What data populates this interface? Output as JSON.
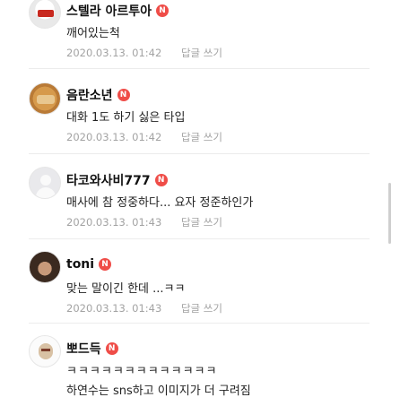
{
  "badge_label": "N",
  "reply_label": "답글 쓰기",
  "comments": [
    {
      "author": "스텔라 아르투아",
      "text": "깨어있는척",
      "timestamp": "2020.03.13. 01:42"
    },
    {
      "author": "음란소년",
      "text": "대화 1도 하기 싫은 타입",
      "timestamp": "2020.03.13. 01:42"
    },
    {
      "author": "타코와사비777",
      "text": "매사에 참 정중하다... 요자 정준하인가",
      "timestamp": "2020.03.13. 01:43"
    },
    {
      "author": "toni",
      "text": "맞는 말이긴 한데 ...ㅋㅋ",
      "timestamp": "2020.03.13. 01:43"
    },
    {
      "author": "뽀드득",
      "text": "ㅋㅋㅋㅋㅋㅋㅋㅋㅋㅋㅋㅋㅋ",
      "text2": "하연수는 sns하고 이미지가 더 구려짐"
    }
  ],
  "colors": {
    "badge": "#ef4d48",
    "meta": "#a3a3a3",
    "divider": "#ececec"
  }
}
